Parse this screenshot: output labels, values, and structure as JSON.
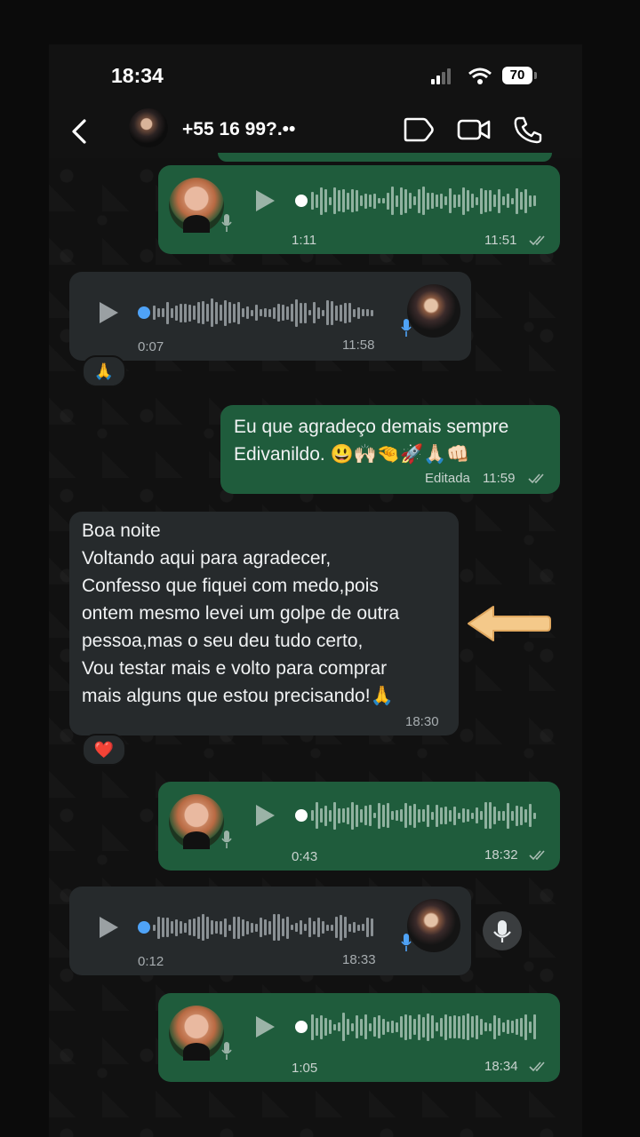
{
  "status_bar": {
    "time": "18:34",
    "battery": "70"
  },
  "header": {
    "contact": "+55 16 99?.••"
  },
  "messages": [
    {
      "type": "voice",
      "direction": "out",
      "duration": "1:11",
      "time": "11:51"
    },
    {
      "type": "voice",
      "direction": "in",
      "duration": "0:07",
      "time": "11:58",
      "reaction": "🙏"
    },
    {
      "type": "text",
      "direction": "out",
      "text": "Eu que agradeço demais sempre\nEdivanildo. 😃🙌🏻🤏🚀🙏🏻👊🏻",
      "time": "11:59",
      "edited": "Editada"
    },
    {
      "type": "text",
      "direction": "in",
      "text": "Boa noite\nVoltando aqui para agradecer,\nConfesso que fiquei com medo,pois\nontem mesmo levei um golpe de outra\npessoa,mas o seu deu tudo certo,\nVou testar mais e volto para comprar\nmais alguns que estou precisando!🙏",
      "time": "18:30",
      "reaction": "❤️"
    },
    {
      "type": "voice",
      "direction": "out",
      "duration": "0:43",
      "time": "18:32"
    },
    {
      "type": "voice",
      "direction": "in",
      "duration": "0:12",
      "time": "18:33"
    },
    {
      "type": "voice",
      "direction": "out",
      "duration": "1:05",
      "time": "18:34"
    }
  ],
  "colors": {
    "outgoing": "#1f5c3c",
    "incoming": "#262a2c",
    "background": "#121212",
    "arrow": "#f4c98a"
  }
}
